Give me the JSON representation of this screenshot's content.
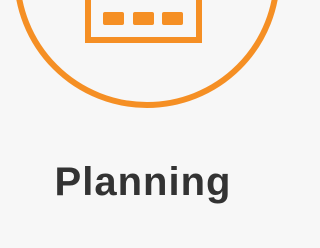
{
  "tile": {
    "label": "Planning",
    "icon": "calendar-icon"
  },
  "colors": {
    "accent": "#f58f24",
    "text": "#333333",
    "background": "#f7f7f7"
  }
}
